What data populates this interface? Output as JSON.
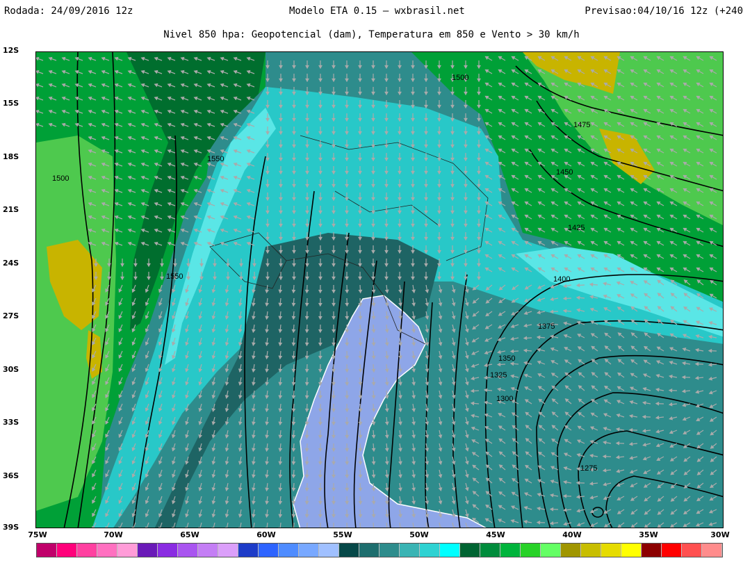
{
  "header": {
    "rodada": "Rodada: 24/09/2016 12z",
    "modelo": "Modelo ETA 0.15 — wxbrasil.net",
    "previsao": "Previsao:04/10/16 12z (+240"
  },
  "subtitle": "Nivel 850 hpa: Geopotencial (dam), Temperatura em 850 e Vento > 30 km/h",
  "map": {
    "lat_labels": [
      "12S",
      "15S",
      "18S",
      "21S",
      "24S",
      "27S",
      "30S",
      "33S",
      "36S",
      "39S"
    ],
    "lon_labels": [
      "75W",
      "70W",
      "65W",
      "60W",
      "55W",
      "50W",
      "45W",
      "40W",
      "35W",
      "30W"
    ],
    "contour_labels": [
      "1500",
      "1475",
      "1450",
      "1425",
      "1400",
      "1375",
      "1350",
      "1325",
      "1300",
      "1275",
      "1550",
      "1550",
      "1500"
    ],
    "colors": {
      "temp_green_dark": "#006e2e",
      "temp_green": "#00a037",
      "temp_green_light": "#4ec94e",
      "temp_olive": "#c8b400",
      "temp_teal_dark": "#1e6464",
      "temp_teal": "#2e8c8c",
      "temp_cyan": "#28c8c8",
      "temp_cyan_light": "#5ae6e6",
      "temp_periwinkle": "#8ea6e8",
      "wind_arrow": "#aaaaaa"
    }
  },
  "colorbar": [
    "#c0006a",
    "#ff007a",
    "#ff40a0",
    "#ff70c0",
    "#ff9cd8",
    "#6a1ab8",
    "#8a2ce2",
    "#a955f0",
    "#c47ef5",
    "#db9ffa",
    "#1e3cc8",
    "#2e64ff",
    "#4f8cff",
    "#78a8ff",
    "#a0c0ff",
    "#064848",
    "#1e6e6e",
    "#2e8c8c",
    "#3ab4b4",
    "#2ed2d2",
    "#00ffff",
    "#006432",
    "#008c3c",
    "#00b43c",
    "#28d228",
    "#64ff64",
    "#a09600",
    "#c8be00",
    "#e6dc00",
    "#ffff00",
    "#8c0000",
    "#ff0000",
    "#ff5050",
    "#ff8c8c"
  ]
}
